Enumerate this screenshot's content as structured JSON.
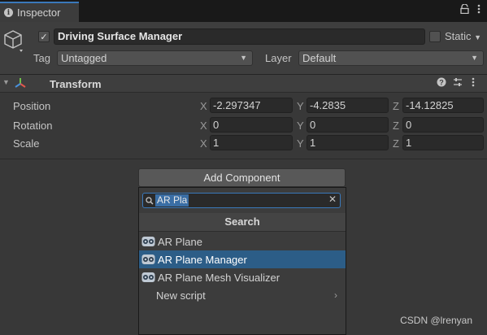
{
  "tab": {
    "title": "Inspector",
    "lock_icon": "lock-icon",
    "menu_icon": "kebab-menu-icon"
  },
  "gameobject": {
    "active": true,
    "name": "Driving Surface Manager",
    "static_label": "Static",
    "static_checked": false,
    "tag_label": "Tag",
    "tag_value": "Untagged",
    "layer_label": "Layer",
    "layer_value": "Default"
  },
  "transform": {
    "title": "Transform",
    "rows": [
      {
        "label": "Position",
        "x": "-2.297347",
        "y": "-4.2835",
        "z": "-14.12825"
      },
      {
        "label": "Rotation",
        "x": "0",
        "y": "0",
        "z": "0"
      },
      {
        "label": "Scale",
        "x": "1",
        "y": "1",
        "z": "1"
      }
    ],
    "axis": {
      "x": "X",
      "y": "Y",
      "z": "Z"
    }
  },
  "add_component": {
    "button_label": "Add Component",
    "search_value": "AR Pla",
    "search_header": "Search",
    "results": [
      {
        "label": "AR Plane",
        "selected": false
      },
      {
        "label": "AR Plane Manager",
        "selected": true
      },
      {
        "label": "AR Plane Mesh Visualizer",
        "selected": false
      }
    ],
    "new_script_label": "New script"
  },
  "watermark": "CSDN @lrenyan",
  "colors": {
    "accent": "#3a79bb",
    "selection": "#2c5d87",
    "panel": "#383838"
  }
}
